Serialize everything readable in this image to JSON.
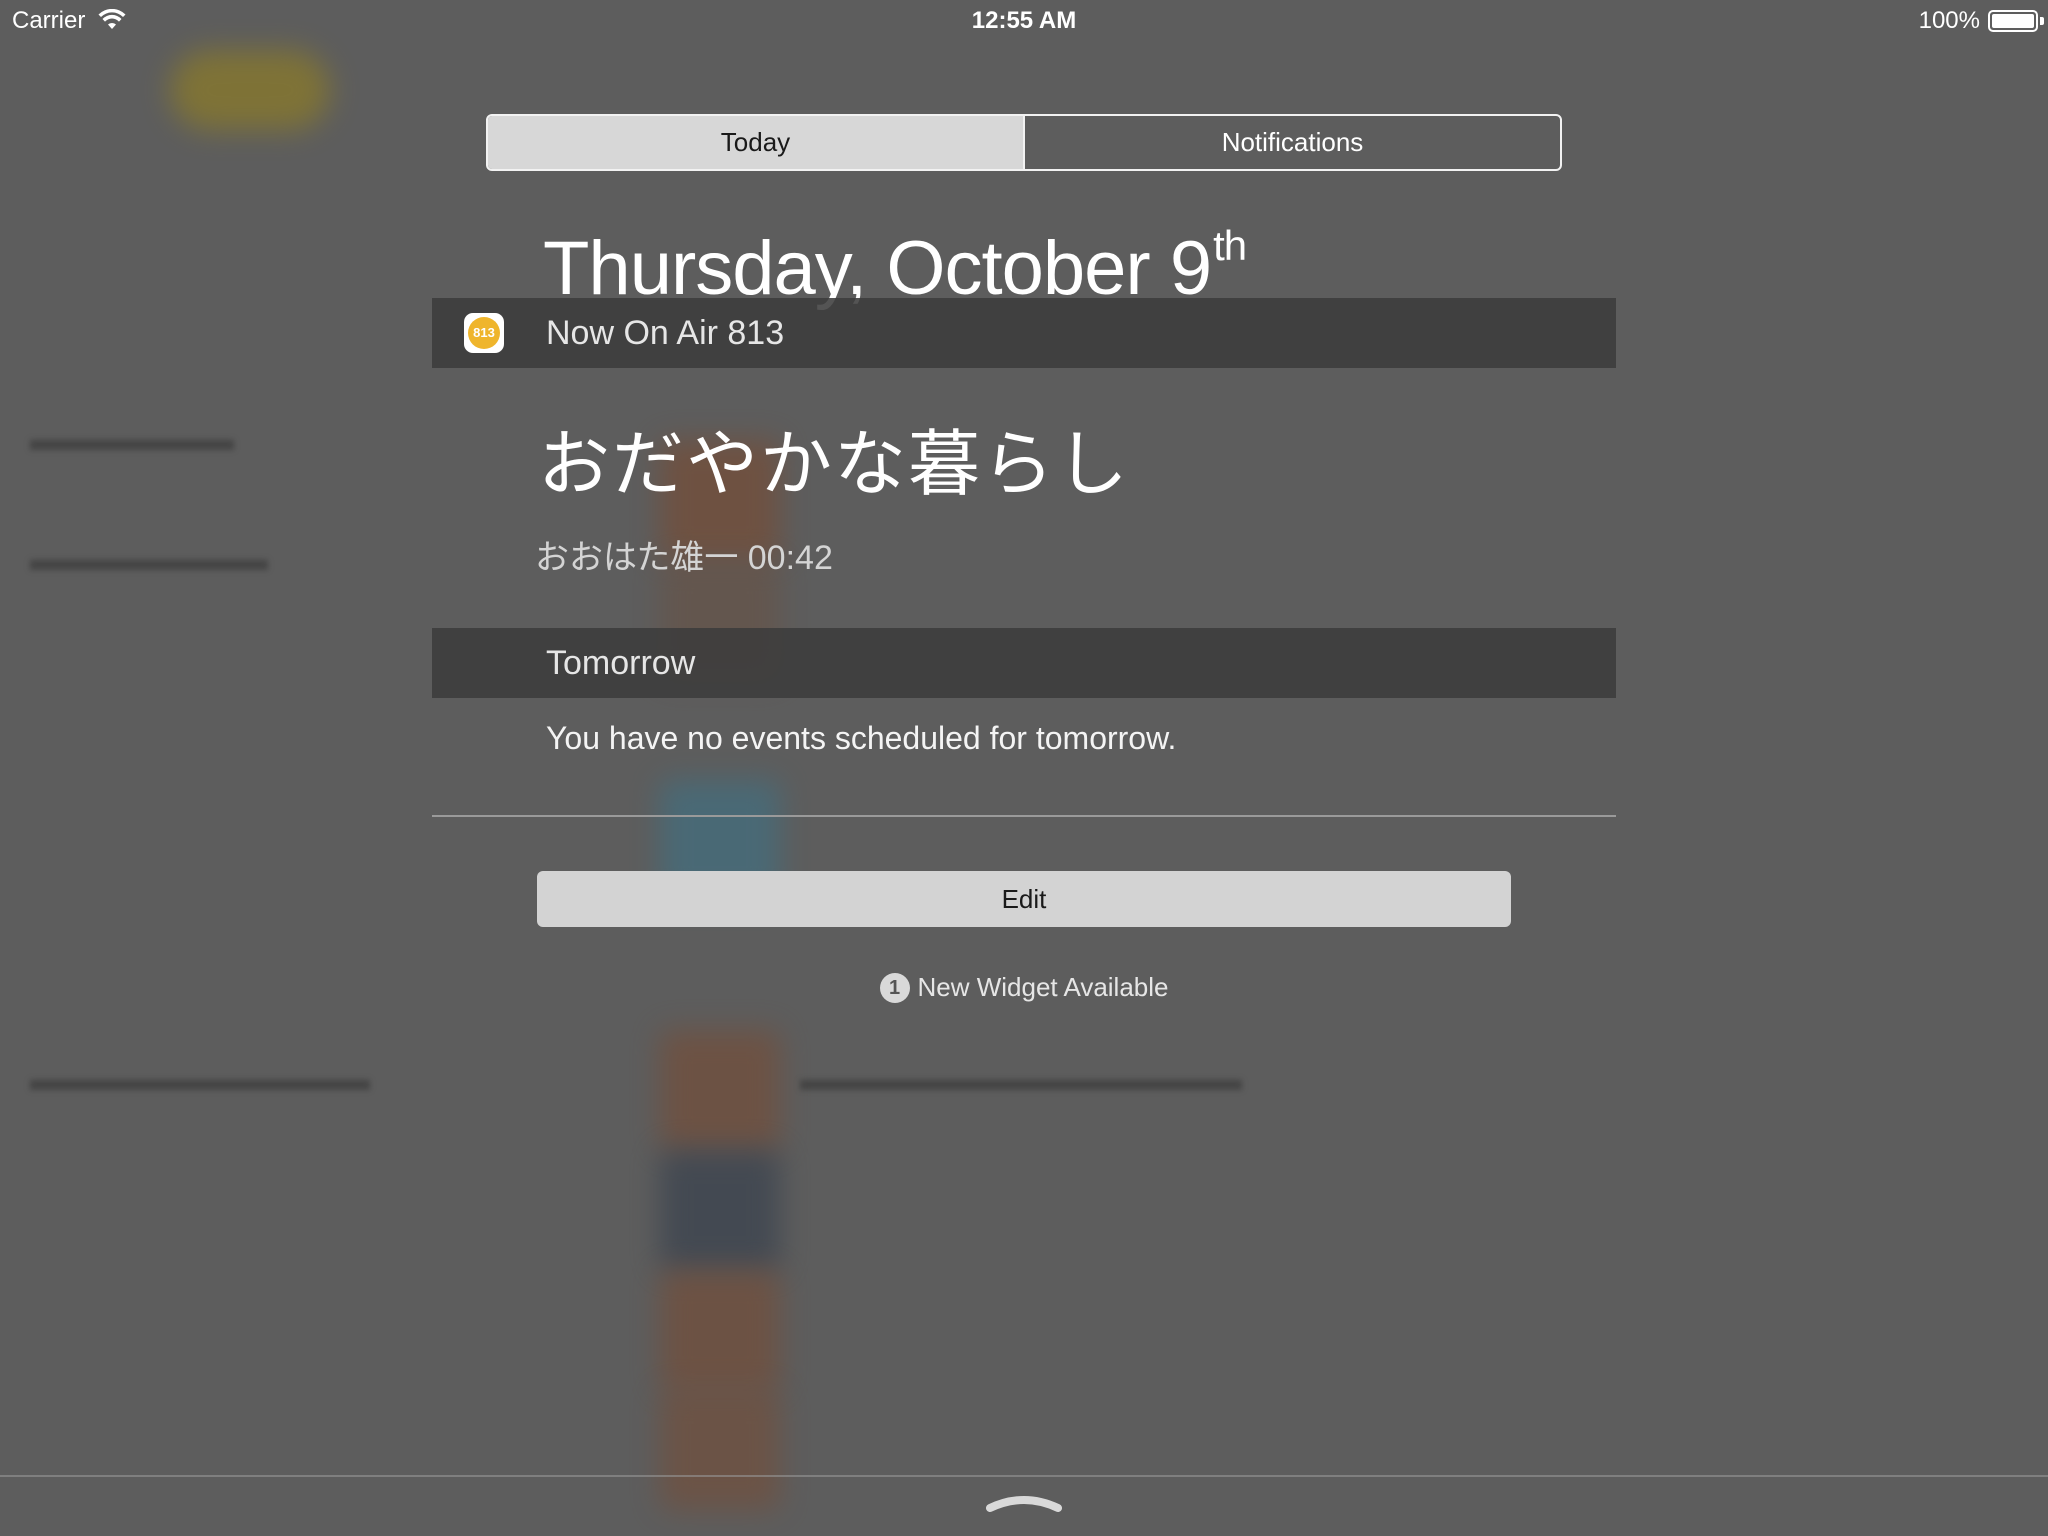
{
  "status_bar": {
    "carrier": "Carrier",
    "time": "12:55 AM",
    "battery_percent": "100%",
    "battery_level": 1.0,
    "wifi_icon": "wifi-icon",
    "battery_icon": "battery-icon"
  },
  "segments": {
    "today": "Today",
    "notifications": "Notifications",
    "selected": "Today"
  },
  "date": {
    "main": "Thursday, October 9",
    "suffix": "th"
  },
  "now_on_air": {
    "title": "Now On Air 813",
    "icon": "813",
    "song_title": "おだやかな暮らし",
    "meta": "おおはた雄一 00:42",
    "icon_color": "#efb52c"
  },
  "tomorrow": {
    "title": "Tomorrow",
    "message": "You have no events scheduled for tomorrow."
  },
  "edit_label": "Edit",
  "new_widget": {
    "count": "1",
    "label": "New Widget Available"
  },
  "colors": {
    "overlay_background": "#5d5d5d",
    "section_bar": "#3c3c3c",
    "segment_active": "#d7d7d7"
  }
}
